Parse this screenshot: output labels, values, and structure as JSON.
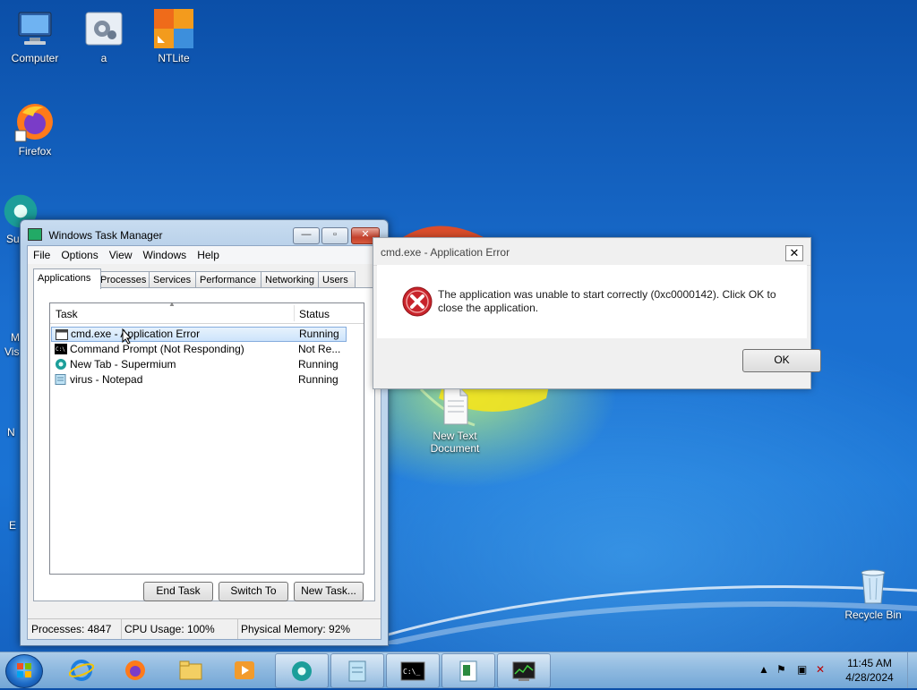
{
  "desktop": {
    "icons": [
      {
        "label": "Computer"
      },
      {
        "label": "a"
      },
      {
        "label": "NTLite"
      },
      {
        "label": "Firefox"
      },
      {
        "label": "New Text Document"
      },
      {
        "label": "Recycle Bin"
      }
    ],
    "partial_labels": [
      "Su",
      "M",
      "Vis",
      "N",
      "E"
    ]
  },
  "task_manager": {
    "title": "Windows Task Manager",
    "menu": [
      "File",
      "Options",
      "View",
      "Windows",
      "Help"
    ],
    "tabs": [
      "Applications",
      "Processes",
      "Services",
      "Performance",
      "Networking",
      "Users"
    ],
    "active_tab": "Applications",
    "columns": {
      "task": "Task",
      "status": "Status"
    },
    "rows": [
      {
        "task": "cmd.exe - Application Error",
        "status": "Running",
        "icon": "window-icon",
        "selected": true
      },
      {
        "task": "Command Prompt (Not Responding)",
        "status": "Not Re...",
        "icon": "cmd-icon",
        "selected": false
      },
      {
        "task": "New Tab - Supermium",
        "status": "Running",
        "icon": "supermium-icon",
        "selected": false
      },
      {
        "task": "virus - Notepad",
        "status": "Running",
        "icon": "notepad-icon",
        "selected": false
      }
    ],
    "buttons": {
      "end_task": "End Task",
      "switch_to": "Switch To",
      "new_task": "New Task..."
    },
    "status": {
      "processes": "Processes: 4847",
      "cpu": "CPU Usage: 100%",
      "memory": "Physical Memory: 92%"
    }
  },
  "error_dialog": {
    "title": "cmd.exe - Application Error",
    "message": "The application was unable to start correctly (0xc0000142). Click OK to close the application.",
    "ok": "OK",
    "close_glyph": "✕"
  },
  "taskbar": {
    "pinned": [
      "internet-explorer-icon",
      "firefox-icon",
      "file-explorer-icon",
      "media-player-icon",
      "supermium-icon",
      "notepad-icon",
      "cmd-icon",
      "notepad-icon",
      "task-manager-icon"
    ],
    "clock": {
      "time": "11:45 AM",
      "date": "4/28/2024"
    }
  },
  "colors": {
    "error_red": "#c8242b",
    "selection": "#cde4fb",
    "taskbar": "#9cc0e2"
  }
}
